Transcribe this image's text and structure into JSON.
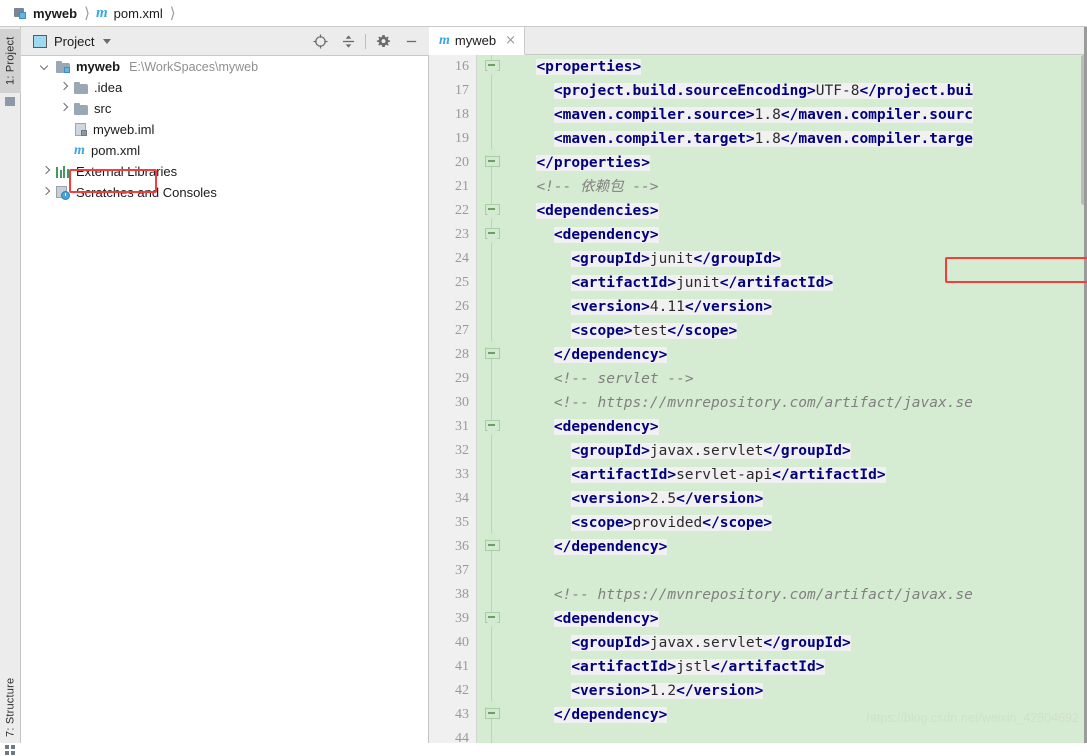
{
  "breadcrumb": {
    "items": [
      {
        "label": "myweb",
        "icon": "module-icon",
        "bold": true
      },
      {
        "label": "pom.xml",
        "icon": "maven-m-icon",
        "bold": false
      }
    ]
  },
  "left_strip": {
    "tabs": [
      {
        "label": "1: Project",
        "icon": "project-panel-icon",
        "active": true
      },
      {
        "label": "7: Structure",
        "icon": "structure-panel-icon",
        "active": false
      }
    ]
  },
  "project_panel": {
    "title": "Project",
    "dropdown_icon": "chevron-down-icon",
    "actions": [
      {
        "name": "locate-icon",
        "glyph": "crosshair"
      },
      {
        "name": "collapse-all-icon",
        "glyph": "collapse"
      },
      {
        "name": "settings-gear-icon",
        "glyph": "gear"
      },
      {
        "name": "hide-panel-icon",
        "glyph": "minus"
      }
    ],
    "tree": [
      {
        "indent": 0,
        "arrow": "down",
        "icon": "module-folder-icon",
        "label": "myweb",
        "bold": true,
        "path": "E:\\WorkSpaces\\myweb"
      },
      {
        "indent": 1,
        "arrow": "right",
        "icon": "folder-icon",
        "label": ".idea",
        "bold": false,
        "path": ""
      },
      {
        "indent": 1,
        "arrow": "right",
        "icon": "folder-icon",
        "label": "src",
        "bold": false,
        "path": ""
      },
      {
        "indent": 1,
        "arrow": "none",
        "icon": "iml-file-icon",
        "label": "myweb.iml",
        "bold": false,
        "path": ""
      },
      {
        "indent": 1,
        "arrow": "none",
        "icon": "maven-m-icon",
        "label": "pom.xml",
        "bold": false,
        "path": "",
        "highlighted": true
      },
      {
        "indent": 0,
        "arrow": "right",
        "icon": "external-libraries-icon",
        "label": "External Libraries",
        "bold": false,
        "path": ""
      },
      {
        "indent": 0,
        "arrow": "right",
        "icon": "scratches-icon",
        "label": "Scratches and Consoles",
        "bold": false,
        "path": ""
      }
    ]
  },
  "editor": {
    "tab": {
      "label": "myweb",
      "icon": "maven-m-icon",
      "close_label": "×"
    },
    "watermark": "https://blog.csdn.net/weixin_42804692",
    "lines": [
      {
        "no": "16",
        "fold": "open",
        "indent": 2,
        "tokens": [
          {
            "t": "tag",
            "s": "<properties>"
          }
        ]
      },
      {
        "no": "17",
        "fold": "none",
        "indent": 4,
        "tokens": [
          {
            "t": "tag",
            "s": "<project.build.sourceEncoding>"
          },
          {
            "t": "val",
            "s": "UTF-8"
          },
          {
            "t": "tag",
            "s": "</project.bui"
          }
        ]
      },
      {
        "no": "18",
        "fold": "none",
        "indent": 4,
        "tokens": [
          {
            "t": "tag",
            "s": "<maven.compiler.source>"
          },
          {
            "t": "val",
            "s": "1.8"
          },
          {
            "t": "tag",
            "s": "</maven.compiler.sourc"
          }
        ]
      },
      {
        "no": "19",
        "fold": "none",
        "indent": 4,
        "tokens": [
          {
            "t": "tag",
            "s": "<maven.compiler.target>"
          },
          {
            "t": "val",
            "s": "1.8"
          },
          {
            "t": "tag",
            "s": "</maven.compiler.targe"
          }
        ]
      },
      {
        "no": "20",
        "fold": "close",
        "indent": 2,
        "tokens": [
          {
            "t": "tag",
            "s": "</properties>"
          }
        ]
      },
      {
        "no": "21",
        "fold": "none",
        "indent": 2,
        "tokens": [
          {
            "t": "cmt",
            "s": "<!-- 依赖包 -->"
          }
        ]
      },
      {
        "no": "22",
        "fold": "open",
        "indent": 2,
        "tokens": [
          {
            "t": "tag",
            "s": "<dependencies>"
          }
        ]
      },
      {
        "no": "23",
        "fold": "open",
        "indent": 4,
        "tokens": [
          {
            "t": "tag",
            "s": "<dependency>"
          }
        ]
      },
      {
        "no": "24",
        "fold": "none",
        "indent": 6,
        "tokens": [
          {
            "t": "tag",
            "s": "<groupId>"
          },
          {
            "t": "val",
            "s": "junit"
          },
          {
            "t": "tag",
            "s": "</groupId>"
          }
        ]
      },
      {
        "no": "25",
        "fold": "none",
        "indent": 6,
        "tokens": [
          {
            "t": "tag",
            "s": "<artifactId>"
          },
          {
            "t": "val",
            "s": "junit"
          },
          {
            "t": "tag",
            "s": "</artifactId>"
          }
        ]
      },
      {
        "no": "26",
        "fold": "none",
        "indent": 6,
        "tokens": [
          {
            "t": "tag",
            "s": "<version>"
          },
          {
            "t": "val",
            "s": "4.11"
          },
          {
            "t": "tag",
            "s": "</version>"
          }
        ]
      },
      {
        "no": "27",
        "fold": "none",
        "indent": 6,
        "tokens": [
          {
            "t": "tag",
            "s": "<scope>"
          },
          {
            "t": "val",
            "s": "test"
          },
          {
            "t": "tag",
            "s": "</scope>"
          }
        ]
      },
      {
        "no": "28",
        "fold": "close",
        "indent": 4,
        "tokens": [
          {
            "t": "tag",
            "s": "</dependency>"
          }
        ]
      },
      {
        "no": "29",
        "fold": "none",
        "indent": 4,
        "tokens": [
          {
            "t": "cmt",
            "s": "<!-- servlet -->"
          }
        ]
      },
      {
        "no": "30",
        "fold": "none",
        "indent": 4,
        "tokens": [
          {
            "t": "cmt",
            "s": "<!-- https://mvnrepository.com/artifact/javax.se"
          }
        ]
      },
      {
        "no": "31",
        "fold": "open",
        "indent": 4,
        "tokens": [
          {
            "t": "tag",
            "s": "<dependency>"
          }
        ]
      },
      {
        "no": "32",
        "fold": "none",
        "indent": 6,
        "tokens": [
          {
            "t": "tag",
            "s": "<groupId>"
          },
          {
            "t": "val",
            "s": "javax.servlet"
          },
          {
            "t": "tag",
            "s": "</groupId>"
          }
        ]
      },
      {
        "no": "33",
        "fold": "none",
        "indent": 6,
        "tokens": [
          {
            "t": "tag",
            "s": "<artifactId>"
          },
          {
            "t": "val",
            "s": "servlet-api"
          },
          {
            "t": "tag",
            "s": "</artifactId>"
          }
        ]
      },
      {
        "no": "34",
        "fold": "none",
        "indent": 6,
        "tokens": [
          {
            "t": "tag",
            "s": "<version>"
          },
          {
            "t": "val",
            "s": "2.5"
          },
          {
            "t": "tag",
            "s": "</version>"
          }
        ]
      },
      {
        "no": "35",
        "fold": "none",
        "indent": 6,
        "tokens": [
          {
            "t": "tag",
            "s": "<scope>"
          },
          {
            "t": "val",
            "s": "provided"
          },
          {
            "t": "tag",
            "s": "</scope>"
          }
        ]
      },
      {
        "no": "36",
        "fold": "close",
        "indent": 4,
        "tokens": [
          {
            "t": "tag",
            "s": "</dependency>"
          }
        ]
      },
      {
        "no": "37",
        "fold": "none",
        "indent": 0,
        "tokens": []
      },
      {
        "no": "38",
        "fold": "none",
        "indent": 4,
        "tokens": [
          {
            "t": "cmt",
            "s": "<!-- https://mvnrepository.com/artifact/javax.se"
          }
        ]
      },
      {
        "no": "39",
        "fold": "open",
        "indent": 4,
        "tokens": [
          {
            "t": "tag",
            "s": "<dependency>"
          }
        ]
      },
      {
        "no": "40",
        "fold": "none",
        "indent": 6,
        "tokens": [
          {
            "t": "tag",
            "s": "<groupId>"
          },
          {
            "t": "val",
            "s": "javax.servlet"
          },
          {
            "t": "tag",
            "s": "</groupId>"
          }
        ]
      },
      {
        "no": "41",
        "fold": "none",
        "indent": 6,
        "tokens": [
          {
            "t": "tag",
            "s": "<artifactId>"
          },
          {
            "t": "val",
            "s": "jstl"
          },
          {
            "t": "tag",
            "s": "</artifactId>"
          }
        ]
      },
      {
        "no": "42",
        "fold": "none",
        "indent": 6,
        "tokens": [
          {
            "t": "tag",
            "s": "<version>"
          },
          {
            "t": "val",
            "s": "1.2"
          },
          {
            "t": "tag",
            "s": "</version>"
          }
        ]
      },
      {
        "no": "43",
        "fold": "close",
        "indent": 4,
        "tokens": [
          {
            "t": "tag",
            "s": "</dependency>"
          }
        ]
      },
      {
        "no": "44",
        "fold": "none",
        "indent": 0,
        "tokens": []
      }
    ]
  },
  "colors": {
    "tag": "#000080",
    "value": "#2b2b2b",
    "comment": "#808080",
    "diff_added_bg": "#d6ecd2",
    "annotation_red": "#f53d3d"
  }
}
